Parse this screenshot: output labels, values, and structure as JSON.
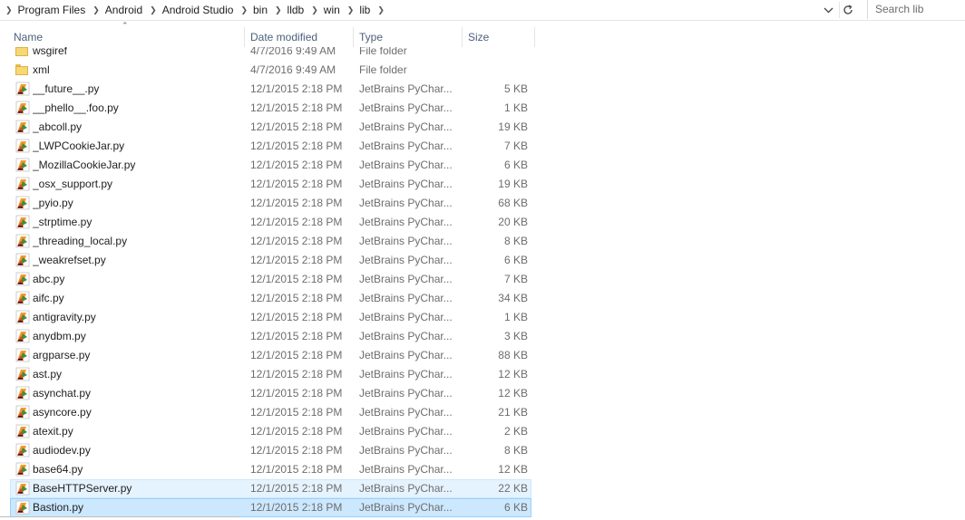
{
  "address_bar": {
    "breadcrumbs": [
      "Program Files",
      "Android",
      "Android Studio",
      "bin",
      "lldb",
      "win",
      "lib"
    ],
    "search_placeholder": "Search lib"
  },
  "columns": {
    "name": "Name",
    "date": "Date modified",
    "type": "Type",
    "size": "Size"
  },
  "files": [
    {
      "name": "wsgiref",
      "date": "4/7/2016 9:49 AM",
      "type": "File folder",
      "size": "",
      "icon": "folder-icon"
    },
    {
      "name": "xml",
      "date": "4/7/2016 9:49 AM",
      "type": "File folder",
      "size": "",
      "icon": "folder-icon"
    },
    {
      "name": "__future__.py",
      "date": "12/1/2015 2:18 PM",
      "type": "JetBrains PyChar...",
      "size": "5 KB",
      "icon": "pycharm-file-icon"
    },
    {
      "name": "__phello__.foo.py",
      "date": "12/1/2015 2:18 PM",
      "type": "JetBrains PyChar...",
      "size": "1 KB",
      "icon": "pycharm-file-icon"
    },
    {
      "name": "_abcoll.py",
      "date": "12/1/2015 2:18 PM",
      "type": "JetBrains PyChar...",
      "size": "19 KB",
      "icon": "pycharm-file-icon"
    },
    {
      "name": "_LWPCookieJar.py",
      "date": "12/1/2015 2:18 PM",
      "type": "JetBrains PyChar...",
      "size": "7 KB",
      "icon": "pycharm-file-icon"
    },
    {
      "name": "_MozillaCookieJar.py",
      "date": "12/1/2015 2:18 PM",
      "type": "JetBrains PyChar...",
      "size": "6 KB",
      "icon": "pycharm-file-icon"
    },
    {
      "name": "_osx_support.py",
      "date": "12/1/2015 2:18 PM",
      "type": "JetBrains PyChar...",
      "size": "19 KB",
      "icon": "pycharm-file-icon"
    },
    {
      "name": "_pyio.py",
      "date": "12/1/2015 2:18 PM",
      "type": "JetBrains PyChar...",
      "size": "68 KB",
      "icon": "pycharm-file-icon"
    },
    {
      "name": "_strptime.py",
      "date": "12/1/2015 2:18 PM",
      "type": "JetBrains PyChar...",
      "size": "20 KB",
      "icon": "pycharm-file-icon"
    },
    {
      "name": "_threading_local.py",
      "date": "12/1/2015 2:18 PM",
      "type": "JetBrains PyChar...",
      "size": "8 KB",
      "icon": "pycharm-file-icon"
    },
    {
      "name": "_weakrefset.py",
      "date": "12/1/2015 2:18 PM",
      "type": "JetBrains PyChar...",
      "size": "6 KB",
      "icon": "pycharm-file-icon"
    },
    {
      "name": "abc.py",
      "date": "12/1/2015 2:18 PM",
      "type": "JetBrains PyChar...",
      "size": "7 KB",
      "icon": "pycharm-file-icon"
    },
    {
      "name": "aifc.py",
      "date": "12/1/2015 2:18 PM",
      "type": "JetBrains PyChar...",
      "size": "34 KB",
      "icon": "pycharm-file-icon"
    },
    {
      "name": "antigravity.py",
      "date": "12/1/2015 2:18 PM",
      "type": "JetBrains PyChar...",
      "size": "1 KB",
      "icon": "pycharm-file-icon"
    },
    {
      "name": "anydbm.py",
      "date": "12/1/2015 2:18 PM",
      "type": "JetBrains PyChar...",
      "size": "3 KB",
      "icon": "pycharm-file-icon"
    },
    {
      "name": "argparse.py",
      "date": "12/1/2015 2:18 PM",
      "type": "JetBrains PyChar...",
      "size": "88 KB",
      "icon": "pycharm-file-icon"
    },
    {
      "name": "ast.py",
      "date": "12/1/2015 2:18 PM",
      "type": "JetBrains PyChar...",
      "size": "12 KB",
      "icon": "pycharm-file-icon"
    },
    {
      "name": "asynchat.py",
      "date": "12/1/2015 2:18 PM",
      "type": "JetBrains PyChar...",
      "size": "12 KB",
      "icon": "pycharm-file-icon"
    },
    {
      "name": "asyncore.py",
      "date": "12/1/2015 2:18 PM",
      "type": "JetBrains PyChar...",
      "size": "21 KB",
      "icon": "pycharm-file-icon"
    },
    {
      "name": "atexit.py",
      "date": "12/1/2015 2:18 PM",
      "type": "JetBrains PyChar...",
      "size": "2 KB",
      "icon": "pycharm-file-icon"
    },
    {
      "name": "audiodev.py",
      "date": "12/1/2015 2:18 PM",
      "type": "JetBrains PyChar...",
      "size": "8 KB",
      "icon": "pycharm-file-icon"
    },
    {
      "name": "base64.py",
      "date": "12/1/2015 2:18 PM",
      "type": "JetBrains PyChar...",
      "size": "12 KB",
      "icon": "pycharm-file-icon"
    },
    {
      "name": "BaseHTTPServer.py",
      "date": "12/1/2015 2:18 PM",
      "type": "JetBrains PyChar...",
      "size": "22 KB",
      "icon": "pycharm-file-icon",
      "state": "hover"
    },
    {
      "name": "Bastion.py",
      "date": "12/1/2015 2:18 PM",
      "type": "JetBrains PyChar...",
      "size": "6 KB",
      "icon": "pycharm-file-icon",
      "state": "selected"
    }
  ],
  "colors": {
    "hover_bg": "#e5f3ff",
    "selected_bg": "#cce8ff",
    "header_text": "#4c607a",
    "folder": "#f8d775"
  }
}
